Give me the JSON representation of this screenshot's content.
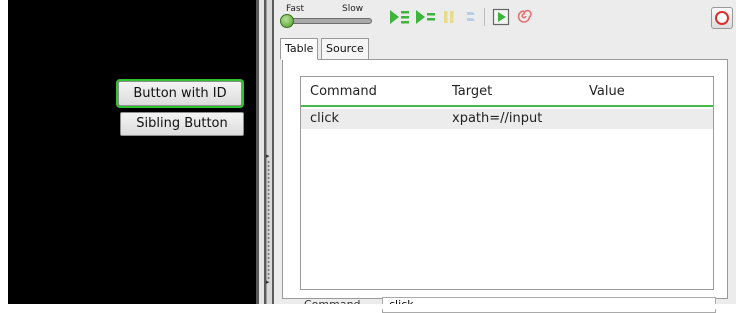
{
  "page": {
    "buttons": {
      "with_id": "Button with ID",
      "sibling": "Sibling Button"
    }
  },
  "toolbar": {
    "speed_fast": "Fast",
    "speed_slow": "Slow",
    "icons": [
      "play-test-suite-icon",
      "play-test-case-icon",
      "pause-icon",
      "step-icon",
      "test-runner-icon",
      "rollup-icon",
      "record-icon"
    ]
  },
  "tabs": [
    "Table",
    "Source"
  ],
  "table": {
    "columns": [
      "Command",
      "Target",
      "Value"
    ],
    "rows": [
      {
        "command": "click",
        "target": "xpath=//input",
        "value": ""
      }
    ]
  },
  "command_field": {
    "label": "Command",
    "value": "click"
  },
  "colors": {
    "highlight": "#2ec42e",
    "header_underline": "#47b84a",
    "record": "#d9302c"
  }
}
